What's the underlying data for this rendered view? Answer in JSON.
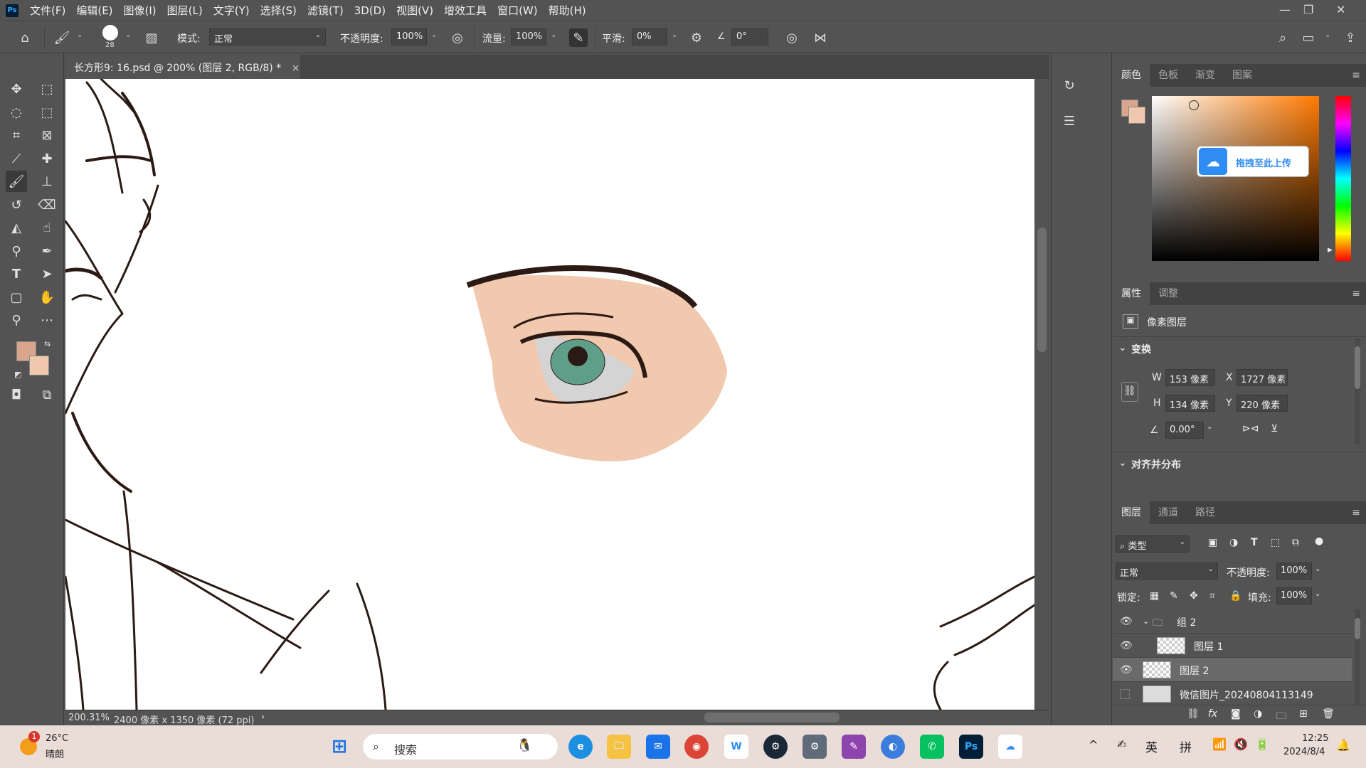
{
  "app": {
    "logo": "Ps"
  },
  "menu": [
    "文件(F)",
    "编辑(E)",
    "图像(I)",
    "图层(L)",
    "文字(Y)",
    "选择(S)",
    "滤镜(T)",
    "3D(D)",
    "视图(V)",
    "增效工具",
    "窗口(W)",
    "帮助(H)"
  ],
  "options": {
    "brush_size": "28",
    "mode_label": "模式:",
    "mode_value": "正常",
    "opacity_label": "不透明度:",
    "opacity_value": "100%",
    "flow_label": "流量:",
    "flow_value": "100%",
    "smoothing_label": "平滑:",
    "smoothing_value": "0%",
    "angle_value": "0°"
  },
  "document": {
    "tab_title": "长方形9: 16.psd @ 200% (图层 2, RGB/8) *",
    "zoom": "200.31%",
    "dimensions": "2400 像素 x 1350 像素 (72 ppi)"
  },
  "colors": {
    "foreground": "#d9a58c",
    "background": "#f0c8ae",
    "skin": "#f0c9ae",
    "iris": "#5f9f8a",
    "ink": "#2b1a14"
  },
  "color_panel": {
    "tabs": [
      "颜色",
      "色板",
      "渐变",
      "图案"
    ],
    "upload_label": "拖拽至此上传"
  },
  "properties_panel": {
    "tabs": [
      "属性",
      "调整"
    ],
    "layer_type": "像素图层",
    "transform_title": "变换",
    "w_label": "W",
    "w_value": "153 像素",
    "h_label": "H",
    "h_value": "134 像素",
    "x_label": "X",
    "x_value": "1727 像素",
    "y_label": "Y",
    "y_value": "220 像素",
    "angle_value": "0.00°",
    "align_title": "对齐并分布"
  },
  "layers_panel": {
    "tabs": [
      "图层",
      "通道",
      "路径"
    ],
    "filter_label": "类型",
    "blend_mode": "正常",
    "opacity_label": "不透明度:",
    "opacity_value": "100%",
    "lock_label": "锁定:",
    "fill_label": "填充:",
    "fill_value": "100%",
    "layers": [
      {
        "name": "组 2",
        "kind": "group"
      },
      {
        "name": "图层 1",
        "kind": "pixel"
      },
      {
        "name": "图层 2",
        "kind": "pixel",
        "selected": true
      },
      {
        "name": "微信图片_20240804113149",
        "kind": "image"
      }
    ]
  },
  "taskbar": {
    "weather_badge": "1",
    "temperature": "26°C",
    "weather": "晴朗",
    "search_placeholder": "搜索",
    "ime_lang": "英",
    "ime_mode": "拼",
    "time": "12:25",
    "date": "2024/8/4"
  }
}
